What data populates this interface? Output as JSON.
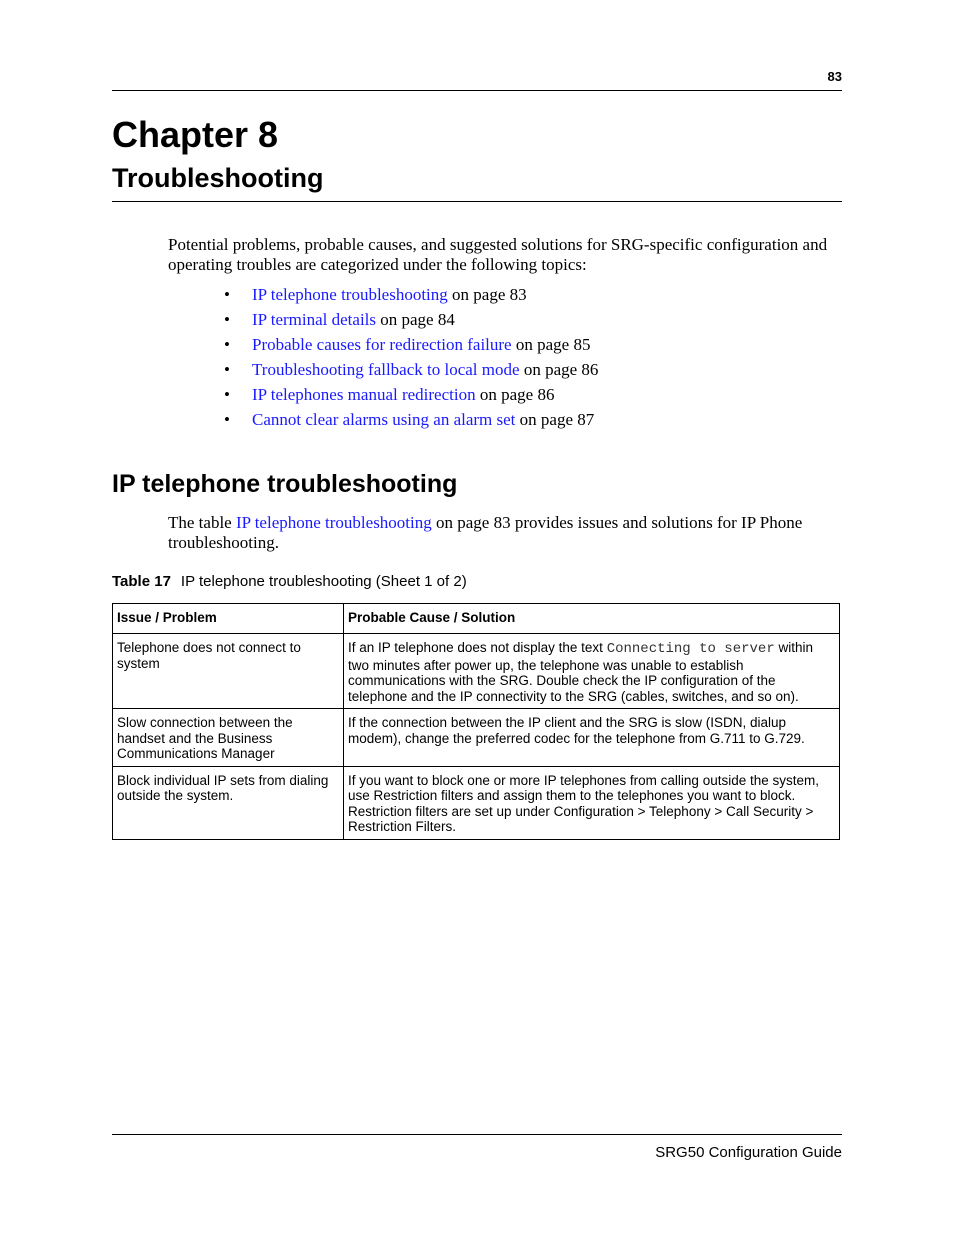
{
  "header": {
    "page_number": "83"
  },
  "chapter": {
    "label": "Chapter 8",
    "title": "Troubleshooting"
  },
  "intro": {
    "text": "Potential problems, probable causes, and suggested solutions for SRG-specific configuration and operating troubles are categorized under the following topics:",
    "bullet": "•",
    "topics": [
      {
        "link": "IP telephone troubleshooting",
        "suffix": " on page 83"
      },
      {
        "link": "IP terminal details",
        "suffix": " on page 84"
      },
      {
        "link": "Probable causes for redirection failure",
        "suffix": " on page 85"
      },
      {
        "link": "Troubleshooting fallback to local mode",
        "suffix": " on page 86"
      },
      {
        "link": "IP telephones manual redirection",
        "suffix": " on page 86"
      },
      {
        "link": "Cannot clear alarms using an alarm set",
        "suffix": " on page 87"
      }
    ]
  },
  "section": {
    "heading": "IP telephone troubleshooting",
    "body_prefix": "The table ",
    "body_link": "IP telephone troubleshooting",
    "body_suffix": " on page 83 provides issues and solutions for IP Phone troubleshooting."
  },
  "table": {
    "caption_label": "Table 17",
    "caption_text": "IP telephone troubleshooting (Sheet 1 of 2)",
    "headers": [
      "Issue / Problem",
      "Probable Cause / Solution"
    ],
    "rows": [
      {
        "issue": "Telephone does not connect to system",
        "solution_prefix": "If an IP telephone does not display the text ",
        "solution_code": "Connecting to server",
        "solution_suffix": " within two minutes after power up, the telephone was unable to establish communications with the SRG. Double check the IP configuration of the telephone and the IP connectivity to the SRG (cables, switches, and so on)."
      },
      {
        "issue": "Slow connection between the handset and the Business Communications Manager",
        "solution": "If the connection between the IP client and the SRG is slow (ISDN, dialup modem), change the preferred codec for the telephone from G.711 to G.729."
      },
      {
        "issue": "Block individual IP sets from dialing outside the system.",
        "solution": "If you want to block one or more IP telephones from calling outside the system, use Restriction filters and assign them to the telephones you want to block. Restriction filters are set up under Configuration > Telephony > Call Security > Restriction Filters."
      }
    ]
  },
  "footer": {
    "text": "SRG50 Configuration Guide"
  },
  "colors": {
    "link": "#1a1aff",
    "text": "#000000",
    "background": "#ffffff"
  }
}
